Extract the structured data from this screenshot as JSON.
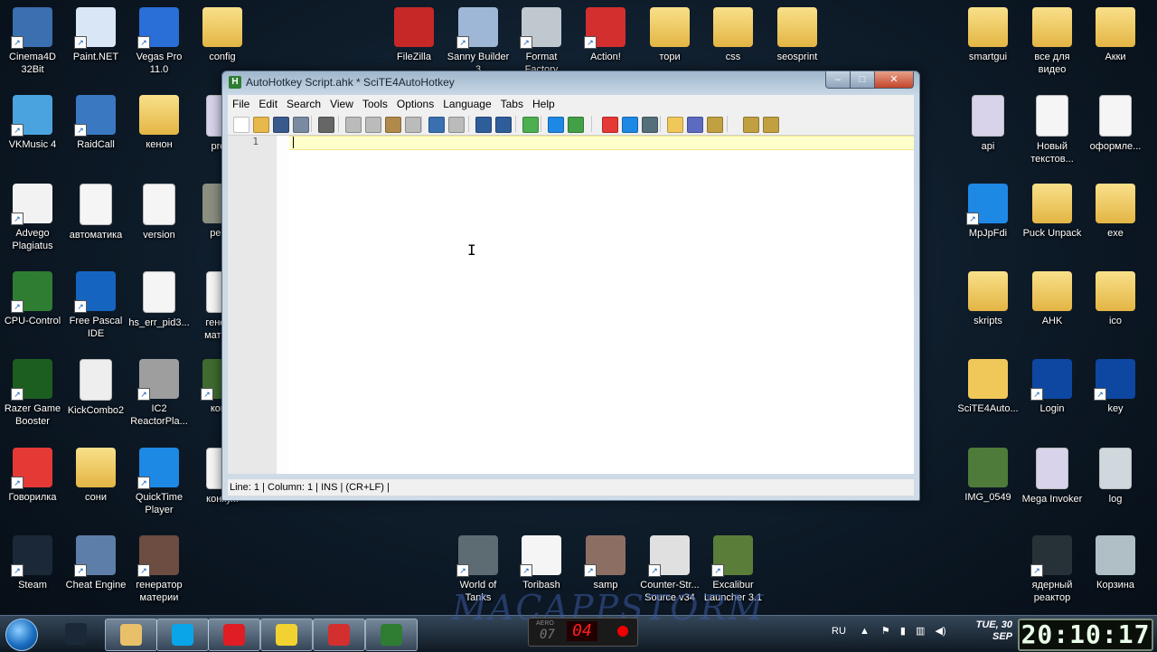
{
  "desktop": {
    "icons": [
      {
        "label": "Cinema4D 32Bit",
        "icon": "cinema4d-icon",
        "color": "#3a6fb0"
      },
      {
        "label": "Paint.NET",
        "icon": "paintnet-icon",
        "color": "#d9e6f5"
      },
      {
        "label": "Vegas Pro 11.0",
        "icon": "vegas-icon",
        "color": "#2a6ed8"
      },
      {
        "label": "config",
        "icon": "folder-icon",
        "color": "#f0c85a"
      },
      {
        "label": "FileZilla",
        "icon": "filezilla-icon",
        "color": "#c62828"
      },
      {
        "label": "Sanny Builder 3",
        "icon": "sanny-builder-icon",
        "color": "#9fb7d6"
      },
      {
        "label": "Format Factory",
        "icon": "format-factory-icon",
        "color": "#bfc7cf"
      },
      {
        "label": "Action!",
        "icon": "action-icon",
        "color": "#d32f2f"
      },
      {
        "label": "тори",
        "icon": "folder-icon",
        "color": "#f0c85a"
      },
      {
        "label": "css",
        "icon": "folder-icon",
        "color": "#f0c85a"
      },
      {
        "label": "seosprint",
        "icon": "folder-icon",
        "color": "#f0c85a"
      },
      {
        "label": "smartgui",
        "icon": "folder-icon",
        "color": "#f0c85a"
      },
      {
        "label": "все для видео",
        "icon": "folder-icon",
        "color": "#f0c85a"
      },
      {
        "label": "Акки",
        "icon": "folder-icon",
        "color": "#f0c85a"
      },
      {
        "label": "VKMusic 4",
        "icon": "vkmusic-icon",
        "color": "#4aa3df"
      },
      {
        "label": "RaidCall",
        "icon": "raidcall-icon",
        "color": "#3b78c2"
      },
      {
        "label": "кенон",
        "icon": "folder-icon",
        "color": "#f0c85a"
      },
      {
        "label": "pro...",
        "icon": "ahk-file-icon",
        "color": "#d8d2ea"
      },
      {
        "label": "api",
        "icon": "ahk-file-icon",
        "color": "#d8d2ea"
      },
      {
        "label": "Новый текстов...",
        "icon": "text-file-icon",
        "color": "#f5f5f5"
      },
      {
        "label": "оформле...",
        "icon": "text-file-icon",
        "color": "#f5f5f5"
      },
      {
        "label": "Advego Plagiatus",
        "icon": "advego-icon",
        "color": "#f2f2f2"
      },
      {
        "label": "автоматика",
        "icon": "text-file-icon",
        "color": "#f5f5f5"
      },
      {
        "label": "version",
        "icon": "text-file-icon",
        "color": "#f5f5f5"
      },
      {
        "label": "pea...",
        "icon": "image-file-icon",
        "color": "#8a8f80"
      },
      {
        "label": "MpJpFdi",
        "icon": "mpjpfdi-icon",
        "color": "#1e88e5"
      },
      {
        "label": "Puck Unpack",
        "icon": "folder-icon",
        "color": "#f0c85a"
      },
      {
        "label": "exe",
        "icon": "folder-icon",
        "color": "#f0c85a"
      },
      {
        "label": "CPU-Control",
        "icon": "cpu-control-icon",
        "color": "#2e7d32"
      },
      {
        "label": "Free Pascal IDE",
        "icon": "free-pascal-icon",
        "color": "#1565c0"
      },
      {
        "label": "hs_err_pid3...",
        "icon": "text-file-icon",
        "color": "#f5f5f5"
      },
      {
        "label": "генер... матер...",
        "icon": "text-file-icon",
        "color": "#f5f5f5"
      },
      {
        "label": "skripts",
        "icon": "folder-icon",
        "color": "#f0c85a"
      },
      {
        "label": "AHK",
        "icon": "folder-icon",
        "color": "#f0c85a"
      },
      {
        "label": "ico",
        "icon": "folder-icon",
        "color": "#f0c85a"
      },
      {
        "label": "Razer Game Booster",
        "icon": "razer-icon",
        "color": "#1b5e20"
      },
      {
        "label": "KickCombo2",
        "icon": "7z-file-icon",
        "color": "#eeeeee"
      },
      {
        "label": "IC2 ReactorPla...",
        "icon": "ic2-reactor-icon",
        "color": "#9e9e9e"
      },
      {
        "label": "кон...",
        "icon": "minecraft-icon",
        "color": "#3e6b2f"
      },
      {
        "label": "SciTE4Auto...",
        "icon": "scite-folder-icon",
        "color": "#f0c85a"
      },
      {
        "label": "Login",
        "icon": "login-icon",
        "color": "#0d47a1"
      },
      {
        "label": "key",
        "icon": "key-icon",
        "color": "#0d47a1"
      },
      {
        "label": "Говорилка",
        "icon": "govorilka-icon",
        "color": "#e53935"
      },
      {
        "label": "сони",
        "icon": "folder-icon",
        "color": "#f0c85a"
      },
      {
        "label": "QuickTime Player",
        "icon": "quicktime-icon",
        "color": "#1e88e5"
      },
      {
        "label": "конку...",
        "icon": "text-file-icon",
        "color": "#f5f5f5"
      },
      {
        "label": "IMG_0549",
        "icon": "image-file-icon",
        "color": "#4e7a3a"
      },
      {
        "label": "Mega Invoker",
        "icon": "ahk-file-icon",
        "color": "#d8d2ea"
      },
      {
        "label": "log",
        "icon": "gear-file-icon",
        "color": "#cfd8dc"
      },
      {
        "label": "Steam",
        "icon": "steam-icon",
        "color": "#1b2838"
      },
      {
        "label": "Cheat Engine",
        "icon": "cheat-engine-icon",
        "color": "#5d7ea8"
      },
      {
        "label": "генератор материи",
        "icon": "film-icon",
        "color": "#6d4c41"
      },
      {
        "label": "World of Tanks",
        "icon": "world-of-tanks-icon",
        "color": "#5d6b73"
      },
      {
        "label": "Toribash",
        "icon": "toribash-icon",
        "color": "#f5f5f5"
      },
      {
        "label": "samp",
        "icon": "samp-icon",
        "color": "#8d6e63"
      },
      {
        "label": "Counter-Str... Source v34",
        "icon": "counter-strike-icon",
        "color": "#e0e0e0"
      },
      {
        "label": "Excalibur Launcher 3.1",
        "icon": "excalibur-icon",
        "color": "#5a7d3a"
      },
      {
        "label": "ядерный реактор",
        "icon": "reactor-icon",
        "color": "#263238"
      },
      {
        "label": "Корзина",
        "icon": "recycle-bin-icon",
        "color": "#b0bec5"
      }
    ]
  },
  "window": {
    "title": "AutoHotkey Script.ahk * SciTE4AutoHotkey",
    "app_icon_letter": "H",
    "minimize_glyph": "–",
    "maximize_glyph": "□",
    "close_glyph": "✕",
    "menu": [
      "File",
      "Edit",
      "Search",
      "View",
      "Tools",
      "Options",
      "Language",
      "Tabs",
      "Help"
    ],
    "toolbar_icons": [
      {
        "name": "new-file-icon",
        "color": "#ffffff"
      },
      {
        "name": "open-folder-icon",
        "color": "#e8b84a"
      },
      {
        "name": "save-icon",
        "color": "#3a5a8c"
      },
      {
        "name": "save-as-icon",
        "color": "#7a8aa0"
      },
      {
        "name": "print-icon",
        "color": "#666666"
      },
      {
        "name": "cut-icon",
        "color": "#bbbbbb"
      },
      {
        "name": "copy-icon",
        "color": "#bbbbbb"
      },
      {
        "name": "paste-icon",
        "color": "#b08a4a"
      },
      {
        "name": "delete-icon",
        "color": "#bbbbbb"
      },
      {
        "name": "undo-icon",
        "color": "#3a6fb0"
      },
      {
        "name": "redo-icon",
        "color": "#bbbbbb"
      },
      {
        "name": "find-icon",
        "color": "#2e5d9a"
      },
      {
        "name": "replace-icon",
        "color": "#2e5d9a"
      },
      {
        "name": "compile-icon",
        "color": "#4caf50"
      },
      {
        "name": "run-icon",
        "color": "#1e88e5"
      },
      {
        "name": "debug-icon",
        "color": "#43a047"
      },
      {
        "name": "window-spy-icon",
        "color": "#e53935"
      },
      {
        "name": "bookmark-icon",
        "color": "#1e88e5"
      },
      {
        "name": "tools-icon",
        "color": "#546e7a"
      },
      {
        "name": "folder-open-icon",
        "color": "#f0c85a"
      },
      {
        "name": "properties-icon",
        "color": "#5c6bc0"
      },
      {
        "name": "settings-icon",
        "color": "#c0a040"
      },
      {
        "name": "help-icon",
        "color": "#c0a040"
      },
      {
        "name": "about-icon",
        "color": "#c0a040"
      }
    ],
    "line_number": "1",
    "status": "Line: 1 | Column: 1 | INS | (CR+LF) |"
  },
  "taskbar": {
    "apps": [
      {
        "name": "steam-icon",
        "color": "#1b2838"
      },
      {
        "name": "explorer-icon",
        "color": "#e8c06a"
      },
      {
        "name": "skype-icon",
        "color": "#0aa5e8"
      },
      {
        "name": "opera-icon",
        "color": "#e01c24"
      },
      {
        "name": "autohotkey-help-icon",
        "color": "#f2d230"
      },
      {
        "name": "action-recorder-icon",
        "color": "#d32f2f"
      },
      {
        "name": "scite-icon",
        "color": "#2e7d32"
      }
    ],
    "language": "RU",
    "date_line1": "TUE, 30",
    "date_line2": "SEP",
    "time": "20:10:17",
    "recorder_label": "AERO",
    "recorder_left": "07",
    "recorder_right": "04",
    "watermark": "MACAPPSTORM"
  }
}
